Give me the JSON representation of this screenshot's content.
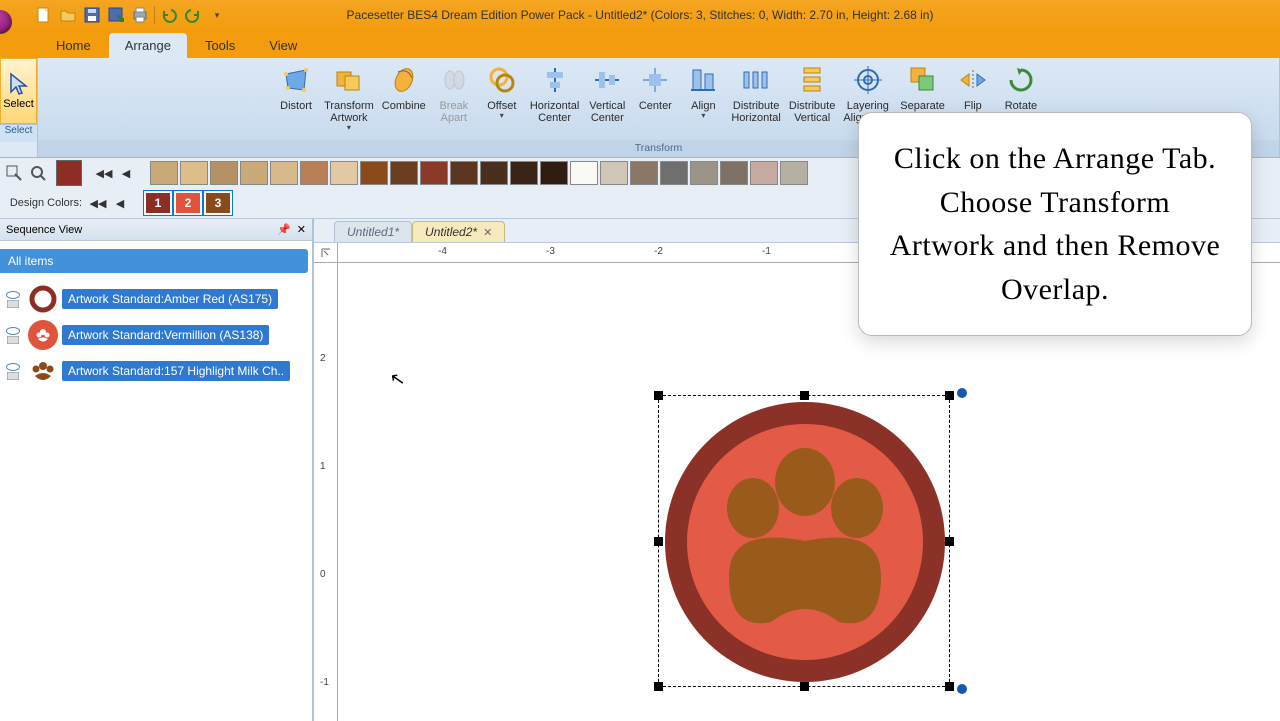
{
  "title": "Pacesetter BES4 Dream Edition Power Pack - Untitled2* (Colors: 3, Stitches: 0, Width: 2.70 in, Height: 2.68 in)",
  "tabs": {
    "home": "Home",
    "arrange": "Arrange",
    "tools": "Tools",
    "view": "View"
  },
  "ribbon": {
    "select": "Select",
    "select_small": "Select",
    "distort": "Distort",
    "transform_artwork": "Transform Artwork",
    "combine": "Combine",
    "break_apart": "Break Apart",
    "offset": "Offset",
    "hcenter": "Horizontal Center",
    "vcenter": "Vertical Center",
    "center": "Center",
    "align": "Align",
    "dist_h": "Distribute Horizontal",
    "dist_v": "Distribute Vertical",
    "layering": "Layering Alignment",
    "sep_layers": "Separate Layers",
    "flip": "Flip",
    "rotate": "Rotate",
    "group_label": "Transform"
  },
  "palette": {
    "design_colors": "Design Colors:",
    "nums": [
      "1",
      "2",
      "3"
    ],
    "colors1": [
      "#c9a977",
      "#ddbe8a",
      "#b59263",
      "#caaa78",
      "#d7b98b",
      "#b97f56",
      "#e2c9a4",
      "#8a4b1c",
      "#6a3d1f",
      "#8b3a2a",
      "#5c3621",
      "#4a2f1c",
      "#3a2417",
      "#2f1c12",
      "#faf9f6",
      "#d0c6b8",
      "#8a7766",
      "#6f6f6f",
      "#9a9488",
      "#7e7266",
      "#c6a9a0",
      "#b6b0a4"
    ],
    "num_colors": [
      "#8c2e24",
      "#e0533d",
      "#8a4b1c"
    ]
  },
  "sequence": {
    "title": "Sequence View",
    "all_items": "All items",
    "items": [
      {
        "label": "Artwork Standard:Amber Red (AS175)"
      },
      {
        "label": "Artwork Standard:Vermillion (AS138)"
      },
      {
        "label": "Artwork Standard:157 Highlight Milk Ch.."
      }
    ]
  },
  "doctabs": {
    "t1": "Untitled1*",
    "t2": "Untitled2*"
  },
  "ruler_h": {
    "m4": "-4",
    "m3": "-3",
    "m2": "-2",
    "m1": "-1"
  },
  "ruler_v": {
    "p2": "2",
    "p1": "1",
    "z": "0",
    "m1": "-1"
  },
  "callout": "Click on the Arrange Tab. Choose Transform Artwork and then Remove Overlap."
}
